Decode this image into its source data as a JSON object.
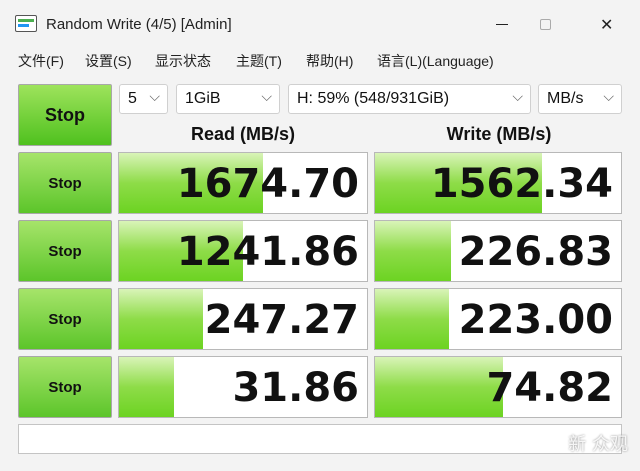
{
  "window": {
    "title": "Random Write (4/5) [Admin]",
    "minimize_glyph": "",
    "close_glyph": "✕"
  },
  "menu": [
    {
      "label": "文件(F)"
    },
    {
      "label": "设置(S)"
    },
    {
      "label": "显示状态"
    },
    {
      "label": "主题(T)"
    },
    {
      "label": "帮助(H)"
    },
    {
      "label": "语言(L)(Language)"
    }
  ],
  "controls": {
    "main_button": "Stop",
    "count": "5",
    "size": "1GiB",
    "drive": "H: 59% (548/931GiB)",
    "unit": "MB/s"
  },
  "columns": {
    "read": "Read (MB/s)",
    "write": "Write (MB/s)"
  },
  "rows": [
    {
      "button": "Stop",
      "read": "1674.70",
      "write": "1562.34",
      "read_level": 0.58,
      "write_level": 0.68
    },
    {
      "button": "Stop",
      "read": "1241.86",
      "write": "226.83",
      "read_level": 0.5,
      "write_level": 0.31
    },
    {
      "button": "Stop",
      "read": "247.27",
      "write": "223.00",
      "read_level": 0.34,
      "write_level": 0.3
    },
    {
      "button": "Stop",
      "read": "31.86",
      "write": "74.82",
      "read_level": 0.22,
      "write_level": 0.52
    }
  ],
  "status_text": "",
  "watermark": "新 众观",
  "colors": {
    "accent_green": "#6cd322",
    "button_green": "#5cc52a"
  }
}
